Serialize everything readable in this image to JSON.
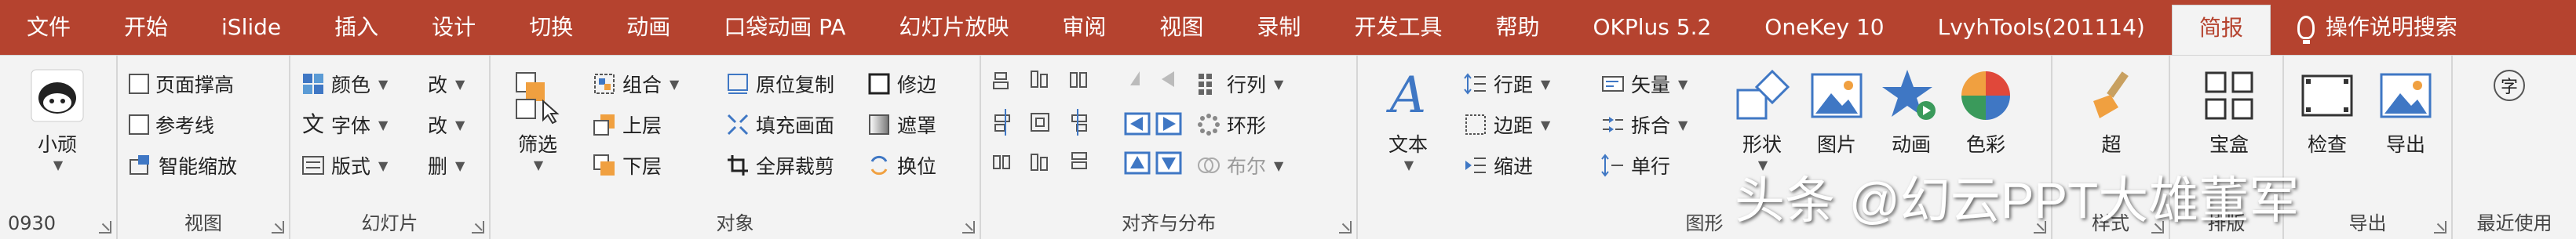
{
  "tabs": [
    "文件",
    "开始",
    "iSlide",
    "插入",
    "设计",
    "切换",
    "动画",
    "口袋动画 PA",
    "幻灯片放映",
    "审阅",
    "视图",
    "录制",
    "开发工具",
    "帮助",
    "OKPlus 5.2",
    "OneKey 10",
    "LvyhTools(201114)",
    "简报",
    "操作说明搜索"
  ],
  "active_tab": "简报",
  "colors": {
    "tabbar": "#b5432f",
    "ribbon": "#f3f3f3",
    "accent_orange": "#f0a040",
    "accent_blue": "#3f77c4"
  },
  "groups": {
    "g0930": {
      "label": "0930",
      "user_label": "小顽"
    },
    "view": {
      "label": "视图",
      "items": [
        "页面撑高",
        "参考线",
        "智能缩放"
      ]
    },
    "slides": {
      "label": "幻灯片",
      "items": [
        "颜色",
        "字体",
        "版式"
      ],
      "side": [
        "改",
        "改",
        "删"
      ]
    },
    "objects": {
      "label": "对象",
      "filter": "筛选",
      "items": [
        "组合",
        "上层",
        "下层",
        "原位复制",
        "填充画面",
        "全屏裁剪",
        "修边",
        "遮罩",
        "换位"
      ]
    },
    "align": {
      "label": "对齐与分布",
      "items": [
        "行列",
        "环形",
        "布尔"
      ]
    },
    "shapes": {
      "label": "图形",
      "items": [
        "文本",
        "行距",
        "边距",
        "缩进",
        "矢量",
        "拆合",
        "单行",
        "形状",
        "图片",
        "动画",
        "色彩"
      ]
    },
    "super": {
      "label": "超",
      "group_label": "样式"
    },
    "layout": {
      "label": "排版",
      "items": [
        "宝盒"
      ]
    },
    "export": {
      "label": "导出",
      "items": [
        "检查",
        "导出"
      ],
      "group_label": "导出"
    },
    "recent": {
      "label": "最近使用",
      "char": "字"
    }
  },
  "watermark": "头条 @幻云PPT大雄董军"
}
